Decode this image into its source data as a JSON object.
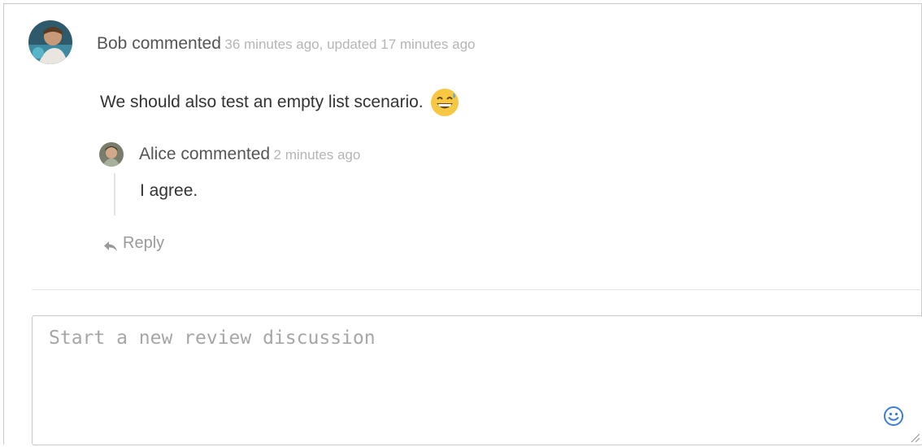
{
  "comment": {
    "author": "Bob commented",
    "time": "36 minutes ago, updated 17 minutes ago",
    "text": "We should also test an empty list scenario.",
    "emoji_icon": "sweat-smile-emoji-icon"
  },
  "reply": {
    "author": "Alice commented",
    "time": "2 minutes ago",
    "text": "I agree."
  },
  "reply_action": {
    "label": "Reply",
    "icon": "reply-arrow-icon"
  },
  "new_discussion": {
    "placeholder": "Start a new review discussion",
    "value": "",
    "emoji_button_icon": "smiley-icon"
  },
  "colors": {
    "accent": "#3b7dd8",
    "emoji_yellow": "#f7c843"
  }
}
